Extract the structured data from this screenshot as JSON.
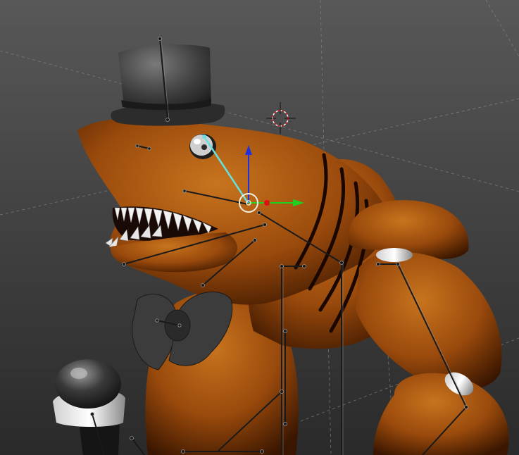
{
  "viewport": {
    "background_top": "#585858",
    "background_bottom": "#2a2a2a",
    "grid_color": "#8a8a8a"
  },
  "model": {
    "body_color": "#9a4a0c",
    "body_highlight": "#c8741e",
    "body_shadow": "#3a1600",
    "accessory_color": "#4a4a4a",
    "teeth_color": "#f2f2f2"
  },
  "gizmo": {
    "x_axis_color": "#20d020",
    "y_axis_color": "#2030e0",
    "center_color": "#e01010",
    "ring_color": "#f0f0e0"
  },
  "armature": {
    "bone_color": "#1a1a1a",
    "bone_outline": "#9a9a9a",
    "selected_bone_color": "#66e0e0"
  },
  "cursor": {
    "ring_color": "#e02020"
  }
}
